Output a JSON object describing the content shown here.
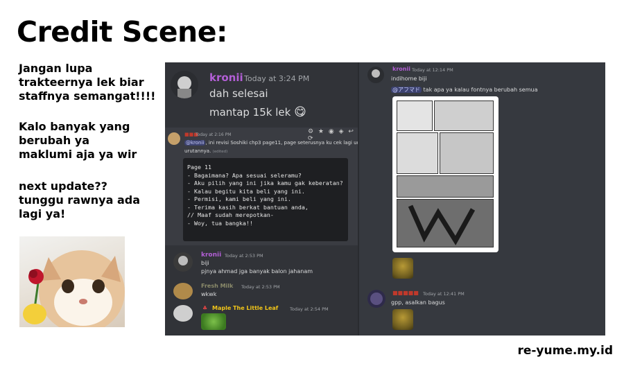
{
  "slide": {
    "title": "Credit Scene:",
    "notes": [
      {
        "lines": [
          "Jangan lupa",
          "trakteernya lek biar",
          "staffnya semangat!!!!"
        ]
      },
      {
        "lines": [
          "Kalo banyak yang",
          "berubah ya",
          "maklumi aja ya wir"
        ]
      },
      {
        "lines": [
          "next update??",
          "tunggu rawnya ada",
          "lagi ya!"
        ]
      }
    ],
    "footer": "re-yume.my.id"
  },
  "chat_left": {
    "top_message": {
      "name": "kronii",
      "time": "Today at 3:24 PM",
      "lines": [
        "dah selesai",
        "mantap 15k lek"
      ],
      "emoji": "😋"
    },
    "revision_message": {
      "time": "Today at 2:16 PM",
      "mention": "@kronii",
      "text1": ", ini revisi Soshiki chp3 page11, page seterusnya ku cek lagi udah bener",
      "text2": "urutannya.",
      "edited": "(edited)",
      "code_lines": [
        "Page 11",
        "- Bagaimana? Apa sesuai seleramu?",
        "- Aku pilih yang ini jika kamu gak keberatan?",
        "- Kalau begitu kita beli yang ini.",
        "- Permisi, kami beli yang ini.",
        "- Terima kasih berkat bantuan anda,",
        "// Maaf sudah merepotkan-",
        "- Woy, tua bangka!!"
      ]
    },
    "msg_kronii2": {
      "name": "kronii",
      "time": "Today at 2:53 PM",
      "lines": [
        "biji",
        "pjnya ahmad jga banyak balon jahanam"
      ]
    },
    "msg_freshmilk": {
      "name": "Fresh Milk",
      "time": "Today at 2:53 PM",
      "lines": [
        "wkwk"
      ]
    },
    "msg_maple": {
      "name": "Maple The Little Leaf",
      "time": "Today at 2:54 PM"
    }
  },
  "chat_right": {
    "msg1": {
      "name": "kronii",
      "time": "Today at 12:14 PM",
      "line1": "indihome biji",
      "mention": "@アフマド",
      "line2": " tak apa ya kalau fontnya berubah semua"
    },
    "msg2": {
      "time": "Today at 12:41 PM",
      "line1": "gpp, asalkan bagus"
    }
  },
  "colors": {
    "kronii": "#b35fd6",
    "freshmilk": "#8a8a6a",
    "maple": "#f0c419",
    "red_name": "#c0392b"
  }
}
